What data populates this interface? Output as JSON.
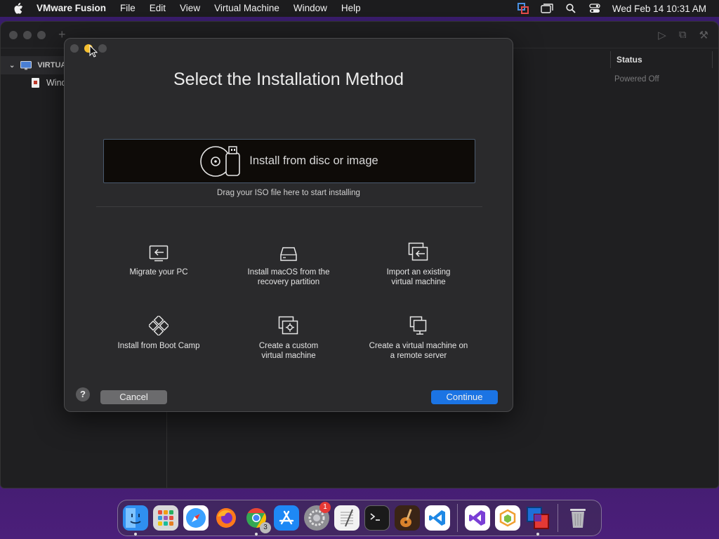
{
  "menubar": {
    "app_name": "VMware Fusion",
    "menus": [
      "File",
      "Edit",
      "View",
      "Virtual Machine",
      "Window",
      "Help"
    ],
    "clock": "Wed Feb 14  10:31 AM",
    "status_icons": [
      "vmware-status-icon",
      "windows-icon",
      "search-icon",
      "control-center-icon"
    ]
  },
  "library": {
    "group_label": "VIRTUA",
    "vm_item_label": "Wind",
    "status_header": "Status",
    "status_value": "Powered Off"
  },
  "dialog": {
    "title": "Select the Installation Method",
    "dropzone_label": "Install from disc or image",
    "dropzone_hint": "Drag your ISO file here to start installing",
    "options": [
      {
        "label": "Migrate your PC",
        "icon": "migrate-pc-icon"
      },
      {
        "label": "Install macOS from the\nrecovery partition",
        "icon": "hard-drive-icon"
      },
      {
        "label": "Import an existing\nvirtual machine",
        "icon": "import-vm-icon"
      },
      {
        "label": "Install from Boot Camp",
        "icon": "boot-camp-icon"
      },
      {
        "label": "Create a custom\nvirtual machine",
        "icon": "custom-vm-icon"
      },
      {
        "label": "Create a virtual machine on\na remote server",
        "icon": "remote-server-icon"
      }
    ],
    "help_label": "?",
    "cancel_label": "Cancel",
    "continue_label": "Continue"
  },
  "dock": {
    "apps": [
      {
        "name": "Finder",
        "icon": "finder-icon",
        "color": "#2f8ff0"
      },
      {
        "name": "Launchpad",
        "icon": "launchpad-icon",
        "color": "#d9d9d9"
      },
      {
        "name": "Safari",
        "icon": "safari-icon",
        "color": "#3aa0ff"
      },
      {
        "name": "Firefox",
        "icon": "firefox-icon",
        "color": "#ff7a1a"
      },
      {
        "name": "Chrome",
        "icon": "chrome-icon",
        "color": "#34a853"
      },
      {
        "name": "App Store",
        "icon": "app-store-icon",
        "color": "#1e88f5"
      },
      {
        "name": "System Settings",
        "icon": "settings-icon",
        "color": "#8e8e93"
      },
      {
        "name": "TextEdit",
        "icon": "textedit-icon",
        "color": "#f2f2f2"
      },
      {
        "name": "Terminal",
        "icon": "terminal-icon",
        "color": "#1a1a1a"
      },
      {
        "name": "GarageBand",
        "icon": "garageband-icon",
        "color": "#6b3b1f"
      },
      {
        "name": "VS Code",
        "icon": "vscode-icon",
        "color": "#ffffff"
      },
      {
        "name": "Visual Studio",
        "icon": "visual-studio-icon",
        "color": "#ffffff"
      },
      {
        "name": "Parallels",
        "icon": "hexagon-app-icon",
        "color": "#ffffff"
      },
      {
        "name": "VMware Fusion",
        "icon": "vmware-fusion-icon",
        "color": "#1d6fd8"
      },
      {
        "name": "Trash",
        "icon": "trash-icon",
        "color": "#c8c8cc"
      }
    ],
    "settings_badge": "1",
    "chrome_badge": "3"
  }
}
